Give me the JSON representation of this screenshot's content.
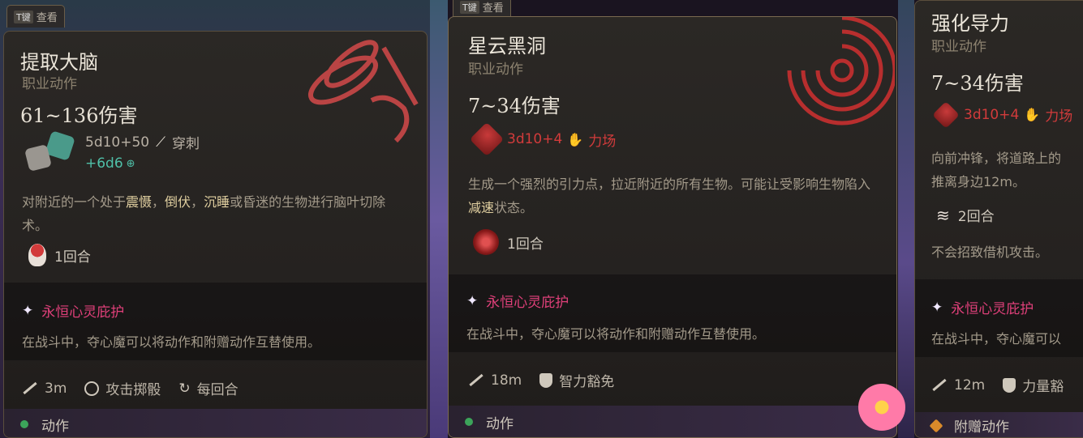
{
  "tabs": [
    {
      "key": "T键",
      "label": "查看"
    },
    {
      "key": "T键",
      "label": "查看"
    }
  ],
  "cards": [
    {
      "title": "提取大脑",
      "subtitle": "职业动作",
      "damage": "61~136伤害",
      "dice_main": "5d10+50",
      "damage_type": "穿刺",
      "dice_extra": "+6d6",
      "desc_parts": [
        "对附近的一个处于",
        "震慑",
        "，",
        "倒伏",
        "，",
        "沉睡",
        "或昏迷的生物进行脑叶切除术。"
      ],
      "cost": "1回合",
      "talent_name": "永恒心灵庇护",
      "talent_desc": "在战斗中，夺心魔可以将动作和附赠动作互替使用。",
      "range": "3m",
      "check": "攻击掷骰",
      "recharge": "每回合",
      "action_type": "动作"
    },
    {
      "title": "星云黑洞",
      "subtitle": "职业动作",
      "damage": "7~34伤害",
      "dice_main": "3d10+4",
      "damage_type": "力场",
      "desc_parts": [
        "生成一个强烈的引力点，拉近附近的所有生物。可能让受影响生物陷入",
        "减速",
        "状态。"
      ],
      "cost": "1回合",
      "talent_name": "永恒心灵庇护",
      "talent_desc": "在战斗中，夺心魔可以将动作和附赠动作互替使用。",
      "range": "18m",
      "check": "智力豁免",
      "action_type": "动作"
    },
    {
      "title": "强化导力",
      "subtitle": "职业动作",
      "damage": "7~34伤害",
      "dice_main": "3d10+4",
      "damage_type": "力场",
      "desc_line1": "向前冲锋，将道路上的",
      "desc_line2": "推离身边12m。",
      "cost": "2回合",
      "note": "不会招致借机攻击。",
      "talent_name": "永恒心灵庇护",
      "talent_desc": "在战斗中，夺心魔可以",
      "range": "12m",
      "check": "力量豁",
      "action_type": "附赠动作"
    }
  ],
  "colors": {
    "accent_red": "#d23b3b",
    "talent_pink": "#e0407a",
    "card_bg": "#252220"
  }
}
